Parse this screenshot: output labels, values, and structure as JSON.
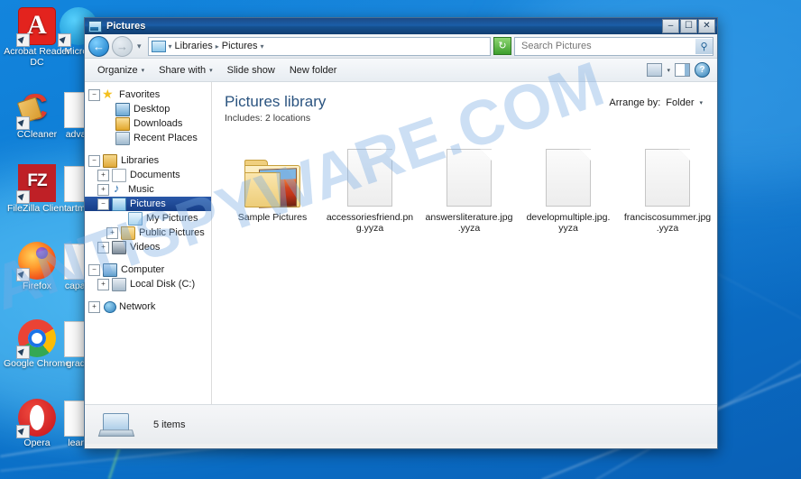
{
  "desktop": {
    "icons_col1": [
      {
        "label": "Acrobat Reader DC",
        "icon": "acrobat-reader-icon"
      },
      {
        "label": "CCleaner",
        "icon": "ccleaner-icon"
      },
      {
        "label": "FileZilla Client",
        "icon": "filezilla-icon"
      },
      {
        "label": "Firefox",
        "icon": "firefox-icon"
      },
      {
        "label": "Google Chrome",
        "icon": "chrome-icon"
      },
      {
        "label": "Opera",
        "icon": "opera-icon"
      }
    ],
    "icons_col2": [
      {
        "label": "Micros",
        "icon": "microsoft-icon"
      },
      {
        "label": "advan",
        "icon": "file-icon"
      },
      {
        "label": "artmu",
        "icon": "file-icon"
      },
      {
        "label": "capaci",
        "icon": "file-icon"
      },
      {
        "label": "grade",
        "icon": "file-icon"
      },
      {
        "label": "learn",
        "icon": "file-icon"
      }
    ]
  },
  "window": {
    "title": "Pictures",
    "buttons": {
      "minimize": "–",
      "maximize": "☐",
      "close": "✕"
    }
  },
  "nav": {
    "back_glyph": "←",
    "forward_glyph": "→",
    "history_caret": "▾",
    "breadcrumbs": [
      "Libraries",
      "Pictures"
    ],
    "separator": "▸",
    "refresh_glyph": "↻",
    "search_placeholder": "Search Pictures",
    "search_value": "",
    "search_icon_glyph": "⚲"
  },
  "toolbar": {
    "organize": "Organize",
    "share_with": "Share with",
    "slide_show": "Slide show",
    "new_folder": "New folder",
    "caret": "▾",
    "help_glyph": "?"
  },
  "sidebar": {
    "groups": [
      {
        "items": [
          {
            "label": "Favorites",
            "expander": "−",
            "icon": "star-icon",
            "indent": 0,
            "selected": false
          },
          {
            "label": "Desktop",
            "expander": "",
            "icon": "monitor-icon",
            "indent": 1,
            "selected": false
          },
          {
            "label": "Downloads",
            "expander": "",
            "icon": "downloads-icon",
            "indent": 1,
            "selected": false
          },
          {
            "label": "Recent Places",
            "expander": "",
            "icon": "recent-places-icon",
            "indent": 1,
            "selected": false
          }
        ]
      },
      {
        "items": [
          {
            "label": "Libraries",
            "expander": "−",
            "icon": "libraries-icon",
            "indent": 0,
            "selected": false
          },
          {
            "label": "Documents",
            "expander": "+",
            "icon": "documents-icon",
            "indent": 1,
            "selected": false
          },
          {
            "label": "Music",
            "expander": "+",
            "icon": "music-icon",
            "indent": 1,
            "selected": false
          },
          {
            "label": "Pictures",
            "expander": "−",
            "icon": "pictures-icon",
            "indent": 1,
            "selected": true
          },
          {
            "label": "My Pictures",
            "expander": "",
            "icon": "my-pictures-icon",
            "indent": 2,
            "selected": false
          },
          {
            "label": "Public Pictures",
            "expander": "+",
            "icon": "public-pictures-icon",
            "indent": 2,
            "selected": false
          },
          {
            "label": "Videos",
            "expander": "+",
            "icon": "videos-icon",
            "indent": 1,
            "selected": false
          }
        ]
      },
      {
        "items": [
          {
            "label": "Computer",
            "expander": "−",
            "icon": "computer-icon",
            "indent": 0,
            "selected": false
          },
          {
            "label": "Local Disk (C:)",
            "expander": "+",
            "icon": "disk-icon",
            "indent": 1,
            "selected": false
          }
        ]
      },
      {
        "items": [
          {
            "label": "Network",
            "expander": "+",
            "icon": "network-icon",
            "indent": 0,
            "selected": false
          }
        ]
      }
    ]
  },
  "library": {
    "title": "Pictures library",
    "includes_label": "Includes:",
    "includes_value": "2 locations",
    "arrange_label": "Arrange by:",
    "arrange_value": "Folder",
    "arrange_caret": "▾"
  },
  "items": [
    {
      "name": "Sample Pictures",
      "type": "folder"
    },
    {
      "name": "accessoriesfriend.png.yyza",
      "type": "file"
    },
    {
      "name": "answersliterature.jpg.yyza",
      "type": "file"
    },
    {
      "name": "developmultiple.jpg.yyza",
      "type": "file"
    },
    {
      "name": "franciscosummer.jpg.yyza",
      "type": "file"
    }
  ],
  "status": {
    "count": "5 items"
  },
  "watermark": {
    "text": "ANTISPYWARE.COM"
  },
  "colors": {
    "selection": "#153d86",
    "title_blue": "#2b5480",
    "desktop_blue": "#0b7fd4"
  }
}
